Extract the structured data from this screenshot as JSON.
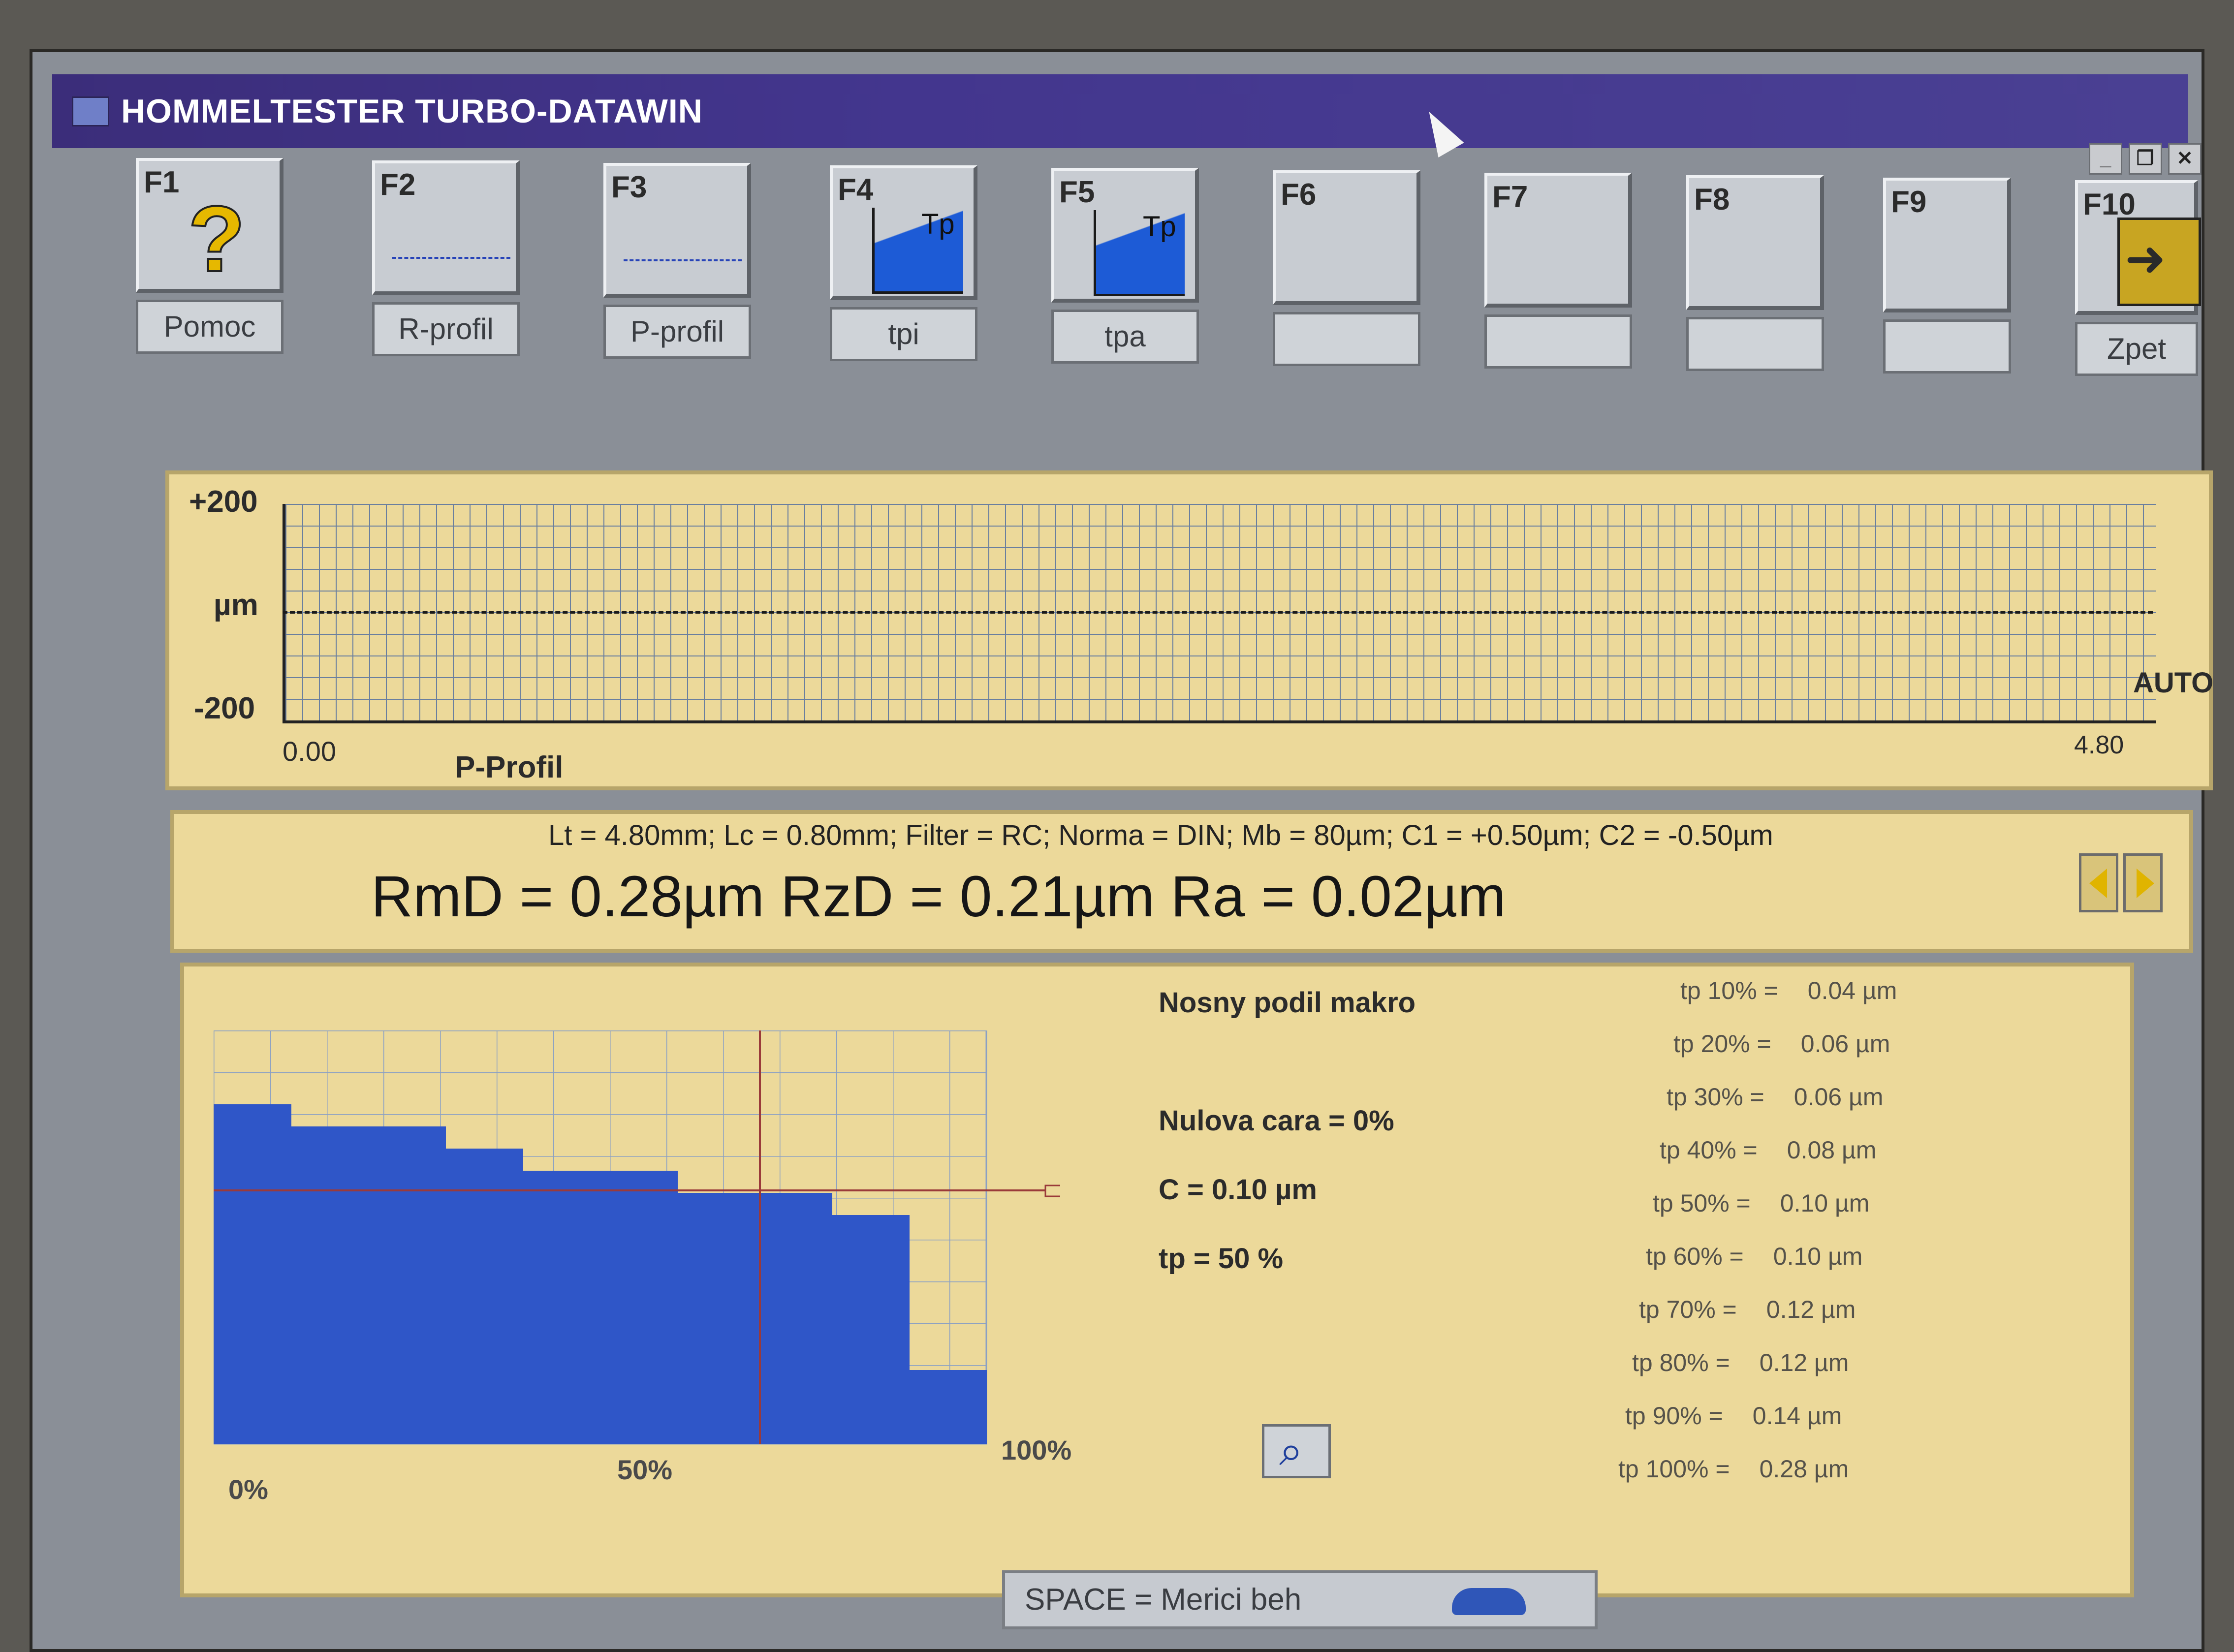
{
  "window": {
    "title": "HOMMELTESTER TURBO-DATAWIN",
    "controls": [
      "_",
      "❐",
      "✕"
    ]
  },
  "fkeys": [
    {
      "key": "F1",
      "label": "Pomoc",
      "icon": "help-icon"
    },
    {
      "key": "F2",
      "label": "R-profil",
      "icon": "r-profile-icon"
    },
    {
      "key": "F3",
      "label": "P-profil",
      "icon": "p-profile-icon"
    },
    {
      "key": "F4",
      "label": "tpi",
      "icon": "tpi-icon",
      "icon_text": "Tp"
    },
    {
      "key": "F5",
      "label": "tpa",
      "icon": "tpa-icon",
      "icon_text": "Tp"
    },
    {
      "key": "F6",
      "label": ""
    },
    {
      "key": "F7",
      "label": ""
    },
    {
      "key": "F8",
      "label": ""
    },
    {
      "key": "F9",
      "label": ""
    },
    {
      "key": "F10",
      "label": "Zpet",
      "icon": "exit-icon"
    }
  ],
  "profile": {
    "y_top": "+200",
    "y_unit": "µm",
    "y_bottom": "-200",
    "x_start": "0.00",
    "x_end": "4.80",
    "name": "P-Profil",
    "scale_mode": "AUTO"
  },
  "params": {
    "settings_line": "Lt = 4.80mm; Lc = 0.80mm; Filter  =  RC; Norma = DIN; Mb =  80µm; C1 = +0.50µm; C2 = -0.50µm",
    "results_line": "RmD = 0.28µm  RzD = 0.21µm  Ra = 0.02µm"
  },
  "bearing": {
    "title": "Nosny podil makro",
    "zero_line": "Nulova cara = 0%",
    "c_value": "C = 0.10 µm",
    "tp_value": "tp = 50 %",
    "x_labels": [
      "0%",
      "50%",
      "100%"
    ],
    "tp_table": [
      {
        "label": "tp  10%  =",
        "value": "0.04 µm"
      },
      {
        "label": "tp  20%  =",
        "value": "0.06 µm"
      },
      {
        "label": "tp  30%  =",
        "value": "0.06 µm"
      },
      {
        "label": "tp  40%  =",
        "value": "0.08 µm"
      },
      {
        "label": "tp  50%  =",
        "value": "0.10 µm"
      },
      {
        "label": "tp  60%  =",
        "value": "0.10 µm"
      },
      {
        "label": "tp  70%  =",
        "value": "0.12 µm"
      },
      {
        "label": "tp  80%  =",
        "value": "0.12 µm"
      },
      {
        "label": "tp  90%  =",
        "value": "0.14 µm"
      },
      {
        "label": "tp 100% =",
        "value": "0.28 µm"
      }
    ]
  },
  "status": {
    "space_hint": "SPACE = Merici beh"
  },
  "colors": {
    "title_bar": "#43368e",
    "panel": "#ecd99a",
    "bearing_fill": "#2f56c8",
    "grid": "#6a7f9f"
  }
}
